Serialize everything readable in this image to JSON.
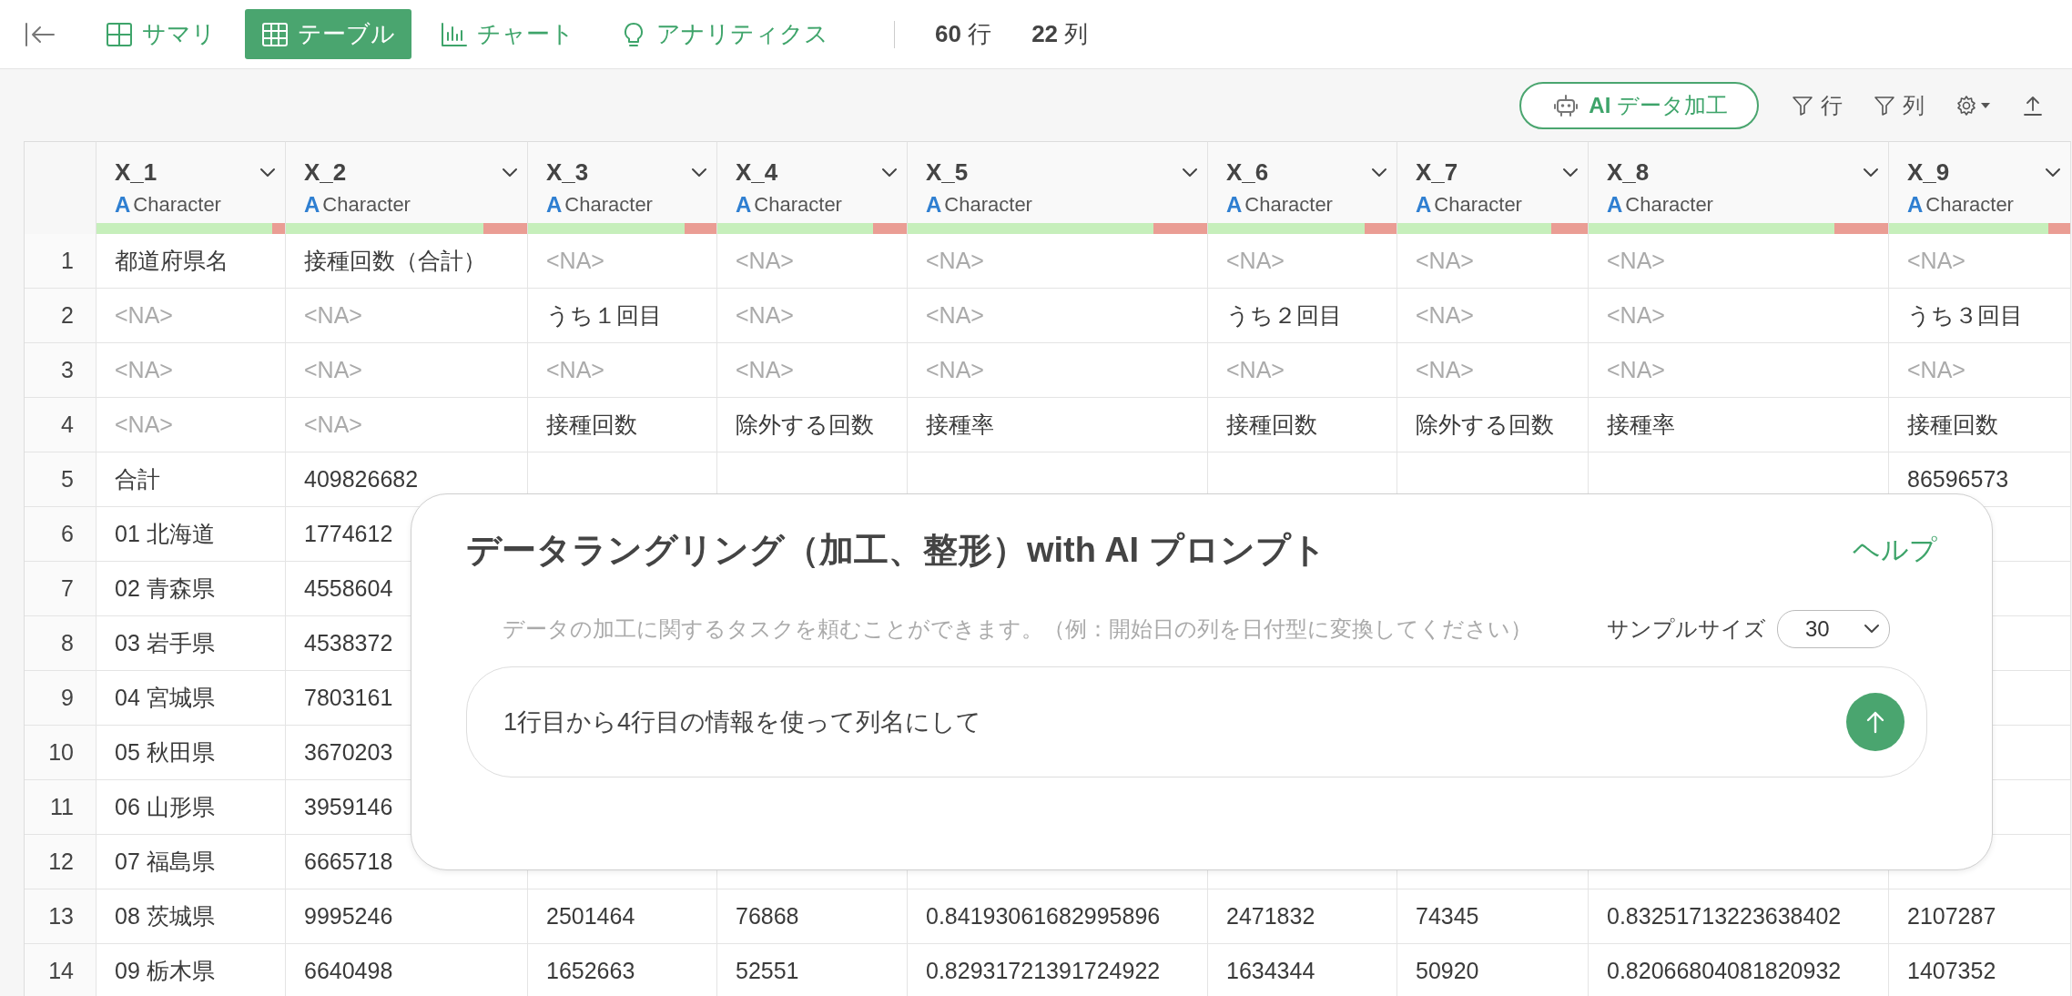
{
  "topbar": {
    "tabs": [
      {
        "label": "サマリ",
        "kind": "summary",
        "selected": false
      },
      {
        "label": "テーブル",
        "kind": "table",
        "selected": true
      },
      {
        "label": "チャート",
        "kind": "chart",
        "selected": false
      },
      {
        "label": "アナリティクス",
        "kind": "analytics",
        "selected": false
      }
    ],
    "counts": [
      {
        "value": "60",
        "unit": "行"
      },
      {
        "value": "22",
        "unit": "列"
      }
    ]
  },
  "toolbar": {
    "ai_button": "**AI** データ加工",
    "filters": [
      {
        "label": "行"
      },
      {
        "label": "列"
      }
    ]
  },
  "table": {
    "columns": [
      {
        "name": "X_1",
        "type_badge": "A",
        "type": "Character",
        "level": 0.93
      },
      {
        "name": "X_2",
        "type_badge": "A",
        "type": "Character",
        "level": 0.82
      },
      {
        "name": "X_3",
        "type_badge": "A",
        "type": "Character",
        "level": 0.83
      },
      {
        "name": "X_4",
        "type_badge": "A",
        "type": "Character",
        "level": 0.82
      },
      {
        "name": "X_5",
        "type_badge": "A",
        "type": "Character",
        "level": 0.82
      },
      {
        "name": "X_6",
        "type_badge": "A",
        "type": "Character",
        "level": 0.83
      },
      {
        "name": "X_7",
        "type_badge": "A",
        "type": "Character",
        "level": 0.81
      },
      {
        "name": "X_8",
        "type_badge": "A",
        "type": "Character",
        "level": 0.82
      },
      {
        "name": "X_9",
        "type_badge": "A",
        "type": "Character",
        "level": 0.88
      }
    ],
    "rows": [
      {
        "number": "1",
        "cells": [
          {
            "text": "都道府県名",
            "na": false
          },
          {
            "text": "接種回数（合計）",
            "na": false
          },
          {
            "text": "<NA>",
            "na": true
          },
          {
            "text": "<NA>",
            "na": true
          },
          {
            "text": "<NA>",
            "na": true
          },
          {
            "text": "<NA>",
            "na": true
          },
          {
            "text": "<NA>",
            "na": true
          },
          {
            "text": "<NA>",
            "na": true
          },
          {
            "text": "<NA>",
            "na": true
          }
        ]
      },
      {
        "number": "2",
        "cells": [
          {
            "text": "<NA>",
            "na": true
          },
          {
            "text": "<NA>",
            "na": true
          },
          {
            "text": "うち１回目",
            "na": false
          },
          {
            "text": "<NA>",
            "na": true
          },
          {
            "text": "<NA>",
            "na": true
          },
          {
            "text": "うち２回目",
            "na": false
          },
          {
            "text": "<NA>",
            "na": true
          },
          {
            "text": "<NA>",
            "na": true
          },
          {
            "text": "うち３回目",
            "na": false
          }
        ]
      },
      {
        "number": "3",
        "cells": [
          {
            "text": "<NA>",
            "na": true
          },
          {
            "text": "<NA>",
            "na": true
          },
          {
            "text": "<NA>",
            "na": true
          },
          {
            "text": "<NA>",
            "na": true
          },
          {
            "text": "<NA>",
            "na": true
          },
          {
            "text": "<NA>",
            "na": true
          },
          {
            "text": "<NA>",
            "na": true
          },
          {
            "text": "<NA>",
            "na": true
          },
          {
            "text": "<NA>",
            "na": true
          }
        ]
      },
      {
        "number": "4",
        "cells": [
          {
            "text": "<NA>",
            "na": true
          },
          {
            "text": "<NA>",
            "na": true
          },
          {
            "text": "接種回数",
            "na": false
          },
          {
            "text": "除外する回数",
            "na": false
          },
          {
            "text": "接種率",
            "na": false
          },
          {
            "text": "接種回数",
            "na": false
          },
          {
            "text": "除外する回数",
            "na": false
          },
          {
            "text": "接種率",
            "na": false
          },
          {
            "text": "接種回数",
            "na": false
          }
        ]
      },
      {
        "number": "5",
        "cells": [
          {
            "text": "合計",
            "na": false
          },
          {
            "text": "409826682",
            "na": false
          },
          null,
          null,
          null,
          null,
          null,
          null,
          {
            "text": "86596573",
            "na": false
          }
        ]
      },
      {
        "number": "6",
        "cells": [
          {
            "text": "01 北海道",
            "na": false
          },
          {
            "text": "1774612",
            "na": false
          }
        ]
      },
      {
        "number": "7",
        "cells": [
          {
            "text": "02 青森県",
            "na": false
          },
          {
            "text": "4558604",
            "na": false
          }
        ]
      },
      {
        "number": "8",
        "cells": [
          {
            "text": "03 岩手県",
            "na": false
          },
          {
            "text": "4538372",
            "na": false
          }
        ]
      },
      {
        "number": "9",
        "cells": [
          {
            "text": "04 宮城県",
            "na": false
          },
          {
            "text": "7803161",
            "na": false
          }
        ]
      },
      {
        "number": "10",
        "cells": [
          {
            "text": "05 秋田県",
            "na": false
          },
          {
            "text": "3670203",
            "na": false
          }
        ]
      },
      {
        "number": "11",
        "cells": [
          {
            "text": "06 山形県",
            "na": false
          },
          {
            "text": "3959146",
            "na": false
          }
        ]
      },
      {
        "number": "12",
        "cells": [
          {
            "text": "07 福島県",
            "na": false
          },
          {
            "text": "6665718",
            "na": false
          }
        ]
      },
      {
        "number": "13",
        "cells": [
          {
            "text": "08 茨城県",
            "na": false
          },
          {
            "text": "9995246",
            "na": false
          },
          {
            "text": "2501464",
            "na": false
          },
          {
            "text": "76868",
            "na": false
          },
          {
            "text": "0.84193061682995896",
            "na": false
          },
          {
            "text": "2471832",
            "na": false
          },
          {
            "text": "74345",
            "na": false
          },
          {
            "text": "0.83251713223638402",
            "na": false
          },
          {
            "text": "2107287",
            "na": false
          }
        ]
      },
      {
        "number": "14",
        "cells": [
          {
            "text": "09 栃木県",
            "na": false
          },
          {
            "text": "6640498",
            "na": false
          },
          {
            "text": "1652663",
            "na": false
          },
          {
            "text": "52551",
            "na": false
          },
          {
            "text": "0.82931721391724922",
            "na": false
          },
          {
            "text": "1634344",
            "na": false
          },
          {
            "text": "50920",
            "na": false
          },
          {
            "text": "0.82066804081820932",
            "na": false
          },
          {
            "text": "1407352",
            "na": false
          }
        ]
      }
    ]
  },
  "dialog": {
    "title": "データラングリング（加工、整形）with AI プロンプト",
    "help": "ヘルプ",
    "hint": "データの加工に関するタスクを頼むことができます。（例：開始日の列を日付型に変換してください）",
    "sample_size": {
      "label": "サンプルサイズ",
      "value": "30"
    },
    "prompt": {
      "value": "1行目から4行目の情報を使って列名にして"
    }
  }
}
